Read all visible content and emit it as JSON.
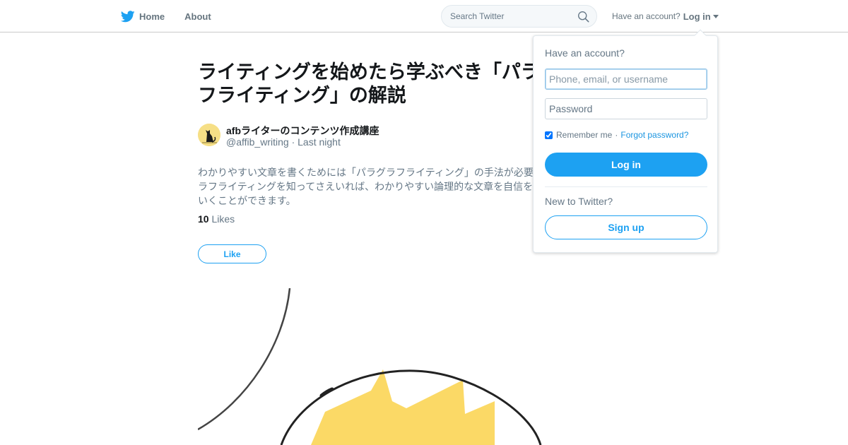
{
  "nav": {
    "home_label": "Home",
    "about_label": "About",
    "search_placeholder": "Search Twitter",
    "have_account": "Have an account?",
    "login_label": "Log in",
    "brand_color": "#1da1f2"
  },
  "tweet": {
    "title": "ライティングを始めたら学ぶべき「パラグラフライティング」の解説",
    "author_name": "afbライターのコンテンツ作成講座",
    "author_handle": "@affib_writing",
    "separator": "·",
    "time": "Last night",
    "body": "わかりやすい文章を書くためには「パラグラフライティング」の手法が必要です。パラグラフライティングを知ってさえいれば、わかりやすい論理的な文章を自信をもって書いていくことができます。",
    "likes_count": "10",
    "likes_label": "Likes",
    "like_button": "Like"
  },
  "login_dropdown": {
    "heading": "Have an account?",
    "username_placeholder": "Phone, email, or username",
    "password_placeholder": "Password",
    "remember_label": "Remember me",
    "separator": "·",
    "forgot_label": "Forgot password?",
    "login_button": "Log in",
    "new_label": "New to Twitter?",
    "signup_button": "Sign up"
  },
  "icons": {
    "bird": "twitter-bird-icon",
    "search": "search-icon",
    "caret": "caret-down-icon"
  }
}
